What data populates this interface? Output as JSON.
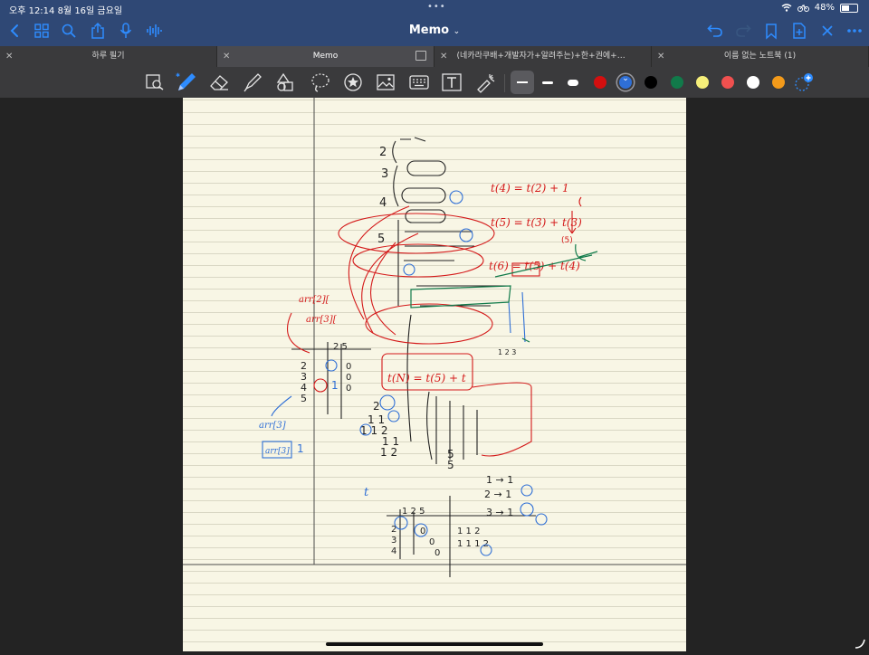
{
  "status_bar": {
    "time_date": "오후 12:14   8월 16일 금요일",
    "dots": "•••",
    "battery": "48%",
    "battery_level": 0.48
  },
  "nav": {
    "title": "Memo",
    "icons": [
      "back-icon",
      "grid-icon",
      "search-icon",
      "share-icon",
      "microphone-icon",
      "waveform-icon",
      "undo-icon",
      "redo-icon",
      "bookmark-icon",
      "add-page-icon",
      "close-icon",
      "more-icon"
    ]
  },
  "tabs": [
    {
      "label": "하루 필기",
      "active": false
    },
    {
      "label": "Memo",
      "active": true
    },
    {
      "label": "(네카라쿠배+개발자가+알려주는)+한+권에+끝내는...",
      "active": false
    },
    {
      "label": "이름 없는 노트북 (1)",
      "active": false
    }
  ],
  "toolbar": {
    "tools": [
      "zoom-icon",
      "pen-icon",
      "eraser-icon",
      "highlighter-icon",
      "shapes-icon",
      "lasso-icon",
      "sticker-icon",
      "image-icon",
      "keyboard-icon",
      "textbox-icon",
      "laser-icon"
    ],
    "colors": [
      "#d40f0f",
      "#2f6fd6",
      "#000000",
      "#117a4a",
      "#f6ef7a",
      "#f0504f",
      "#ffffff",
      "#f39a1a"
    ]
  },
  "notes": {
    "t4": "t(4) = t(2) + 1",
    "t5": "t(5) = t(3) + t(3)",
    "t6": "t(6) = t(5) + t(4)",
    "tn": "t(N) = t(5) + t",
    "arr2": "arr[2][",
    "arr3": "arr[3][",
    "arrblue": "arr[3]",
    "arrbox": "arr[3]",
    "seq": "1 2 3"
  }
}
